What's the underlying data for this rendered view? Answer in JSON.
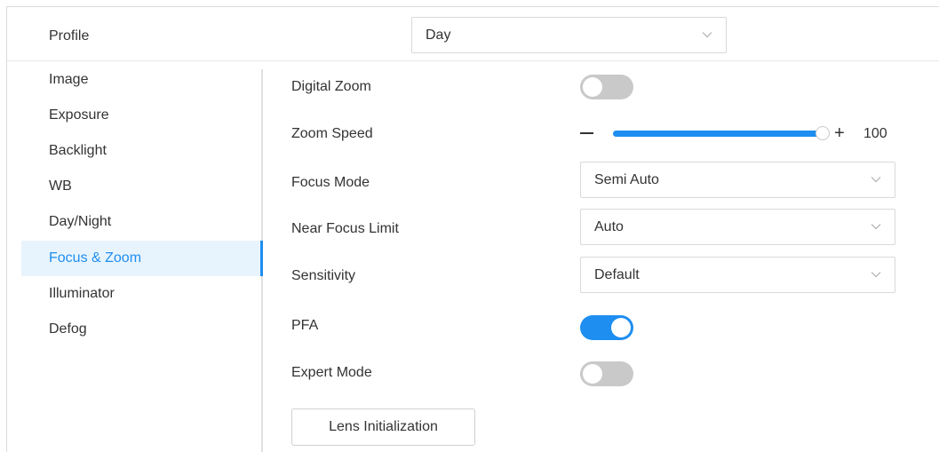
{
  "profile": {
    "label": "Profile",
    "value": "Day"
  },
  "sidebar": {
    "active_index": 5,
    "items": [
      {
        "label": "Image"
      },
      {
        "label": "Exposure"
      },
      {
        "label": "Backlight"
      },
      {
        "label": "WB"
      },
      {
        "label": "Day/Night"
      },
      {
        "label": "Focus & Zoom"
      },
      {
        "label": "Illuminator"
      },
      {
        "label": "Defog"
      }
    ]
  },
  "form": {
    "digital_zoom": {
      "label": "Digital Zoom",
      "on": false
    },
    "zoom_speed": {
      "label": "Zoom Speed",
      "value": "100",
      "minus": "−",
      "plus": "+",
      "fraction": 1.0
    },
    "focus_mode": {
      "label": "Focus Mode",
      "value": "Semi Auto"
    },
    "near_focus_limit": {
      "label": "Near Focus Limit",
      "value": "Auto"
    },
    "sensitivity": {
      "label": "Sensitivity",
      "value": "Default"
    },
    "pfa": {
      "label": "PFA",
      "on": true
    },
    "expert_mode": {
      "label": "Expert Mode",
      "on": false
    },
    "lens_init_label": "Lens Initialization"
  },
  "icons": {
    "dropdown": "chevron-down-icon"
  },
  "colors": {
    "accent": "#1e8ef0",
    "toggle_off": "#c9c9c9",
    "active_bg": "#e8f4fd"
  }
}
